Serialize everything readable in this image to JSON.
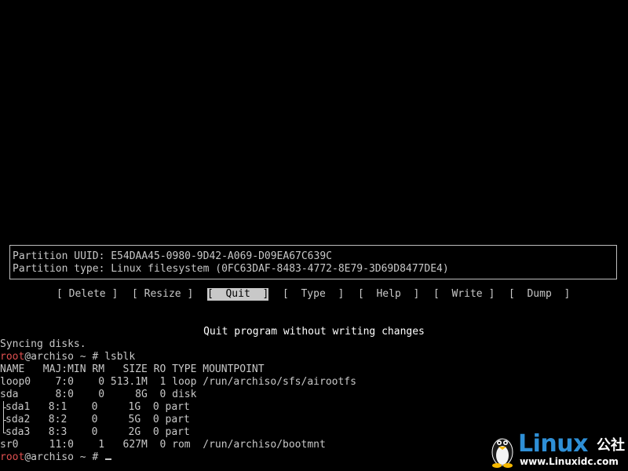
{
  "partition_info": {
    "uuid_line": "Partition UUID: E54DAA45-0980-9D42-A069-D09EA67C639C",
    "type_line": "Partition type: Linux filesystem (0FC63DAF-8483-4772-8E79-3D69D8477DE4)"
  },
  "menu": {
    "delete": "[ Delete ]",
    "resize": "[ Resize ]",
    "quit": "[  Quit  ]",
    "type": "[  Type  ]",
    "help": "[  Help  ]",
    "write": "[  Write ]",
    "dump": "[  Dump  ]",
    "selected": "quit"
  },
  "hint": "Quit program without writing changes",
  "console": {
    "syncing": "Syncing disks.",
    "prompt_user": "root",
    "prompt_host": "@archiso ~ # ",
    "command": "lsblk",
    "header": "NAME   MAJ:MIN RM   SIZE RO TYPE MOUNTPOINT",
    "rows": [
      "loop0    7:0    0 513.1M  1 loop /run/archiso/sfs/airootfs",
      "sda      8:0    0     8G  0 disk",
      "sda1   8:1    0     1G  0 part",
      "sda2   8:2    0     5G  0 part",
      "sda3   8:3    0     2G  0 part",
      "sr0     11:0    1   627M  0 rom  /run/archiso/bootmnt"
    ]
  },
  "watermark": {
    "brand": "Linux",
    "cn": "公社",
    "url": "www.Linuxidc.com"
  },
  "colors": {
    "background": "#000000",
    "text": "#c8c8c8",
    "prompt_user": "#e05050",
    "watermark_blue": "#2e8fd6"
  }
}
